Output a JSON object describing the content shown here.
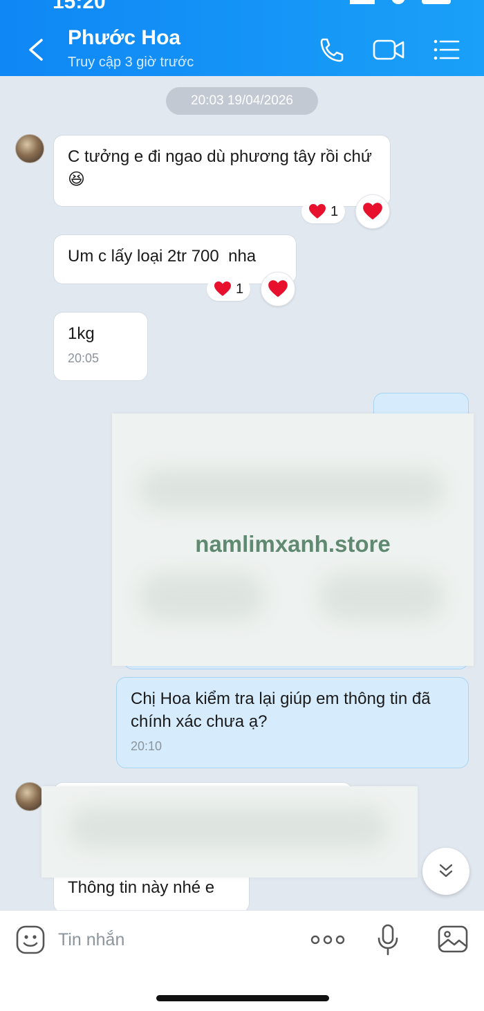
{
  "status": {
    "time": "15:20"
  },
  "header": {
    "title": "Phước Hoa",
    "subtitle": "Truy cập 3 giờ trước"
  },
  "chat": {
    "date_divider": "20:03 19/04/2026",
    "messages": [
      {
        "text": "C tưởng e đi ngao dù phương tây rồi chứ 😆",
        "reaction_count": "1",
        "reaction_icon": "heart-icon"
      },
      {
        "text": "Um c lấy loại 2tr 700  nha",
        "reaction_count": "1",
        "reaction_icon": "heart-icon"
      },
      {
        "text": "1kg",
        "time": "20:05"
      },
      {
        "text": "Chị Hoa kiểm tra lại giúp em thông tin đã chính xác chưa ạ?",
        "time": "20:10"
      },
      {
        "text": "Thông tin này nhé e"
      }
    ],
    "watermark": "namlimxanh.store"
  },
  "input_bar": {
    "placeholder": "Tin nhắn"
  },
  "colors": {
    "header": "#0f87f5",
    "chat_bg": "#e2e8f0",
    "my_bubble": "#d6ecfd",
    "heart": "#e8112d"
  }
}
